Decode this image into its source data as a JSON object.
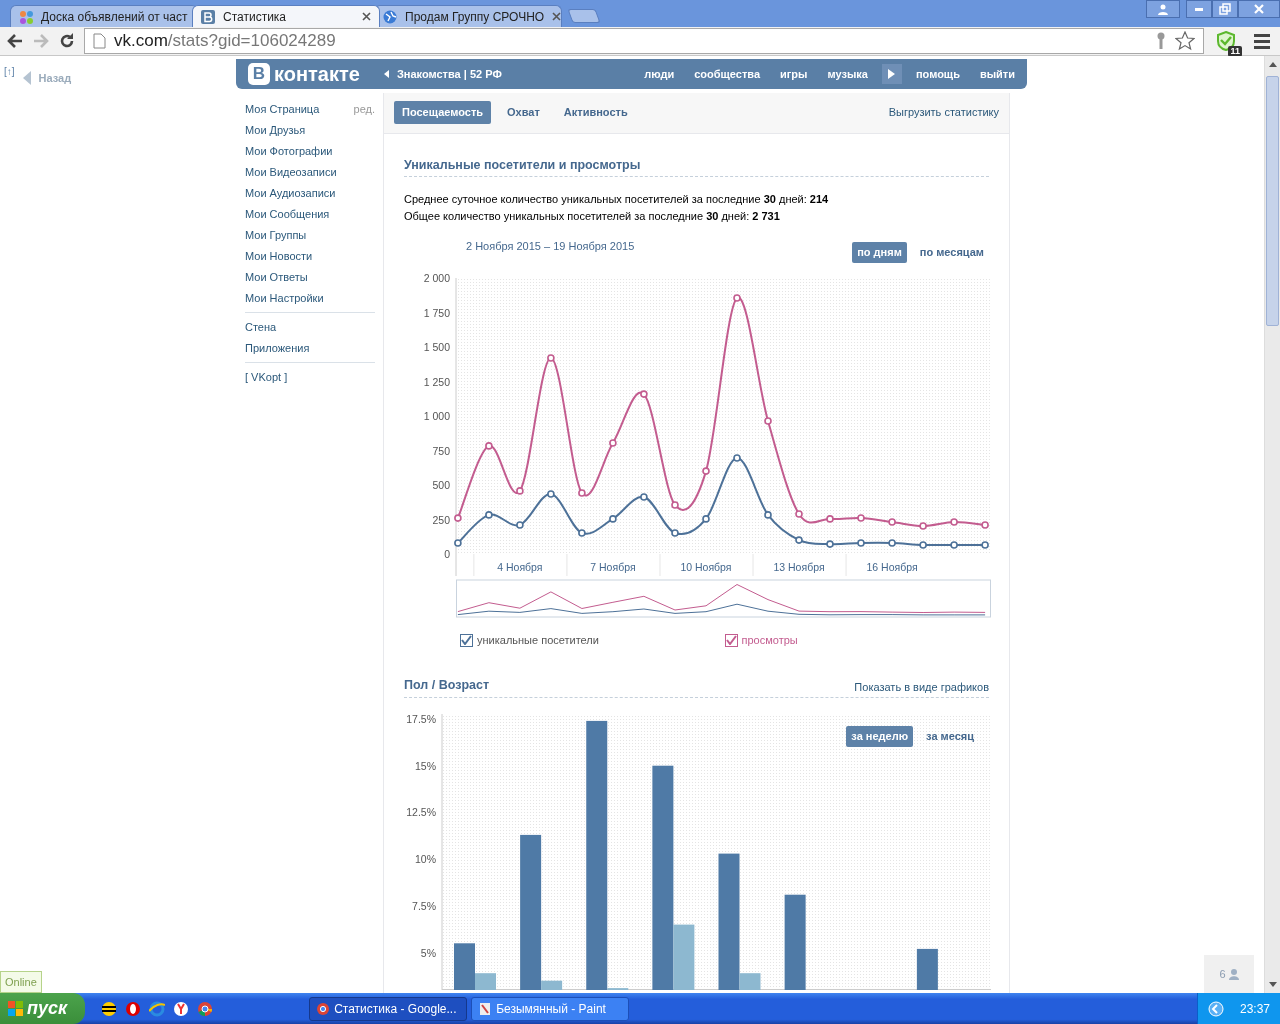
{
  "browser": {
    "tabs": [
      {
        "title": "Доска объявлений от част",
        "selected": false,
        "kind": "dots"
      },
      {
        "title": "Статистика",
        "selected": true,
        "kind": "vk"
      },
      {
        "title": "Продам Группу СРОЧНО",
        "selected": false,
        "kind": "globe"
      }
    ],
    "address": "vk.com/stats?gid=106024289",
    "extension_badge": "11"
  },
  "page": {
    "back_marker": "[↑]",
    "back": "Назад"
  },
  "header": {
    "logo_letter": "В",
    "logo": "контакте",
    "ad": "Знакомства | 52 РФ",
    "nav": [
      {
        "kind": "link",
        "label": "люди"
      },
      {
        "kind": "link",
        "label": "сообщества"
      },
      {
        "kind": "link",
        "label": "игры"
      },
      {
        "kind": "link",
        "label": "музыка"
      },
      {
        "kind": "player"
      },
      {
        "kind": "link",
        "label": "помощь"
      },
      {
        "kind": "link",
        "label": "выйти"
      }
    ]
  },
  "sidebar": {
    "edit": "ред.",
    "groups": [
      [
        {
          "label": "Моя Страница"
        },
        {
          "label": "Мои Друзья"
        },
        {
          "label": "Мои Фотографии"
        },
        {
          "label": "Мои Видеозаписи"
        },
        {
          "label": "Мои Аудиозаписи"
        },
        {
          "label": "Мои Сообщения"
        },
        {
          "label": "Мои Группы"
        },
        {
          "label": "Мои Новости"
        },
        {
          "label": "Мои Ответы"
        },
        {
          "label": "Мои Настройки"
        }
      ],
      [
        {
          "label": "Стена"
        },
        {
          "label": "Приложения"
        }
      ],
      [
        {
          "label": "[ VKopt ]"
        }
      ]
    ]
  },
  "tabs": [
    {
      "label": "Посещаемость",
      "selected": true
    },
    {
      "label": "Охват",
      "selected": false
    },
    {
      "label": "Активность",
      "selected": false
    }
  ],
  "export_link": "Выгрузить статистику",
  "visitors": {
    "title": "Уникальные посетители и просмотры",
    "summary": [
      "Среднее суточное количество уникальных посетителей за последние **30** дней: **214**",
      "Общее количество уникальных посетителей за последние **30** дней: **2 731**"
    ],
    "date_range": "2 Ноября 2015 – 19 Ноября 2015",
    "periods": [
      {
        "label": "по дням",
        "selected": true
      },
      {
        "label": "по месяцам",
        "selected": false
      }
    ],
    "chart_data": {
      "type": "line",
      "x": [
        2,
        3,
        4,
        5,
        6,
        7,
        8,
        9,
        10,
        11,
        12,
        13,
        14,
        15,
        16,
        17,
        18,
        19
      ],
      "series": [
        {
          "name": "уникальные посетители",
          "color": "#4d7198",
          "marker": "circle",
          "values": [
            80,
            283,
            210,
            435,
            152,
            254,
            413,
            152,
            254,
            696,
            283,
            101,
            72,
            80,
            80,
            65,
            65,
            65
          ]
        },
        {
          "name": "просмотры",
          "color": "#c35c8f",
          "marker": "circle",
          "values": [
            260,
            783,
            457,
            1420,
            442,
            804,
            1159,
            355,
            601,
            1855,
            964,
            290,
            254,
            261,
            232,
            203,
            232,
            210
          ]
        }
      ],
      "xlim": [
        1.94,
        19.19
      ],
      "ylim": [
        0,
        2000
      ],
      "yticks": [
        {
          "value": 0,
          "label": "0"
        },
        {
          "value": 250,
          "label": "250"
        },
        {
          "value": 500,
          "label": "500"
        },
        {
          "value": 750,
          "label": "750"
        },
        {
          "value": 1000,
          "label": "1 000"
        },
        {
          "value": 1250,
          "label": "1 250"
        },
        {
          "value": 1500,
          "label": "1 500"
        },
        {
          "value": 1750,
          "label": "1 750"
        },
        {
          "value": 2000,
          "label": "2 000"
        }
      ],
      "xticks": [
        {
          "value": 4,
          "label": "4 Ноября"
        },
        {
          "value": 7,
          "label": "7 Ноября"
        },
        {
          "value": 10,
          "label": "10 Ноября"
        },
        {
          "value": 13,
          "label": "13 Ноября"
        },
        {
          "value": 16,
          "label": "16 Ноября"
        }
      ]
    },
    "legend": [
      {
        "checked": true
      },
      {
        "checked": true
      }
    ]
  },
  "demographics": {
    "title": "Пол / Возраст",
    "toggle_link": "Показать в виде графиков",
    "periods": [
      {
        "label": "за неделю",
        "selected": true
      },
      {
        "label": "за месяц",
        "selected": false
      }
    ],
    "chart_data": {
      "type": "bar",
      "categories": [
        null,
        null,
        null,
        null,
        null,
        null,
        null,
        null
      ],
      "series": [
        {
          "color": "#4f7aa6",
          "values": [
            5.5,
            11.3,
            17.4,
            15.0,
            10.3,
            8.1,
            null,
            5.2
          ]
        },
        {
          "color": "#8db8d0",
          "values": [
            3.9,
            3.5,
            3.1,
            6.5,
            3.9,
            null,
            null,
            null
          ]
        }
      ],
      "ylim": [
        3.0,
        17.5
      ],
      "yticks": [
        {
          "value": 5,
          "label": "5%"
        },
        {
          "value": 7.5,
          "label": "7.5%"
        },
        {
          "value": 10,
          "label": "10%"
        },
        {
          "value": 12.5,
          "label": "12.5%"
        },
        {
          "value": 15,
          "label": "15%"
        },
        {
          "value": 17.5,
          "label": "17.5%"
        }
      ]
    }
  },
  "widgets": {
    "online": "Online",
    "counter": "6"
  },
  "taskbar": {
    "start": "пуск",
    "tasks": [
      {
        "label": "Статистика - Google...",
        "selected": true,
        "kind": "chrome"
      },
      {
        "label": "Безымянный - Paint",
        "selected": false,
        "kind": "paint"
      }
    ],
    "clock": "23:37"
  }
}
